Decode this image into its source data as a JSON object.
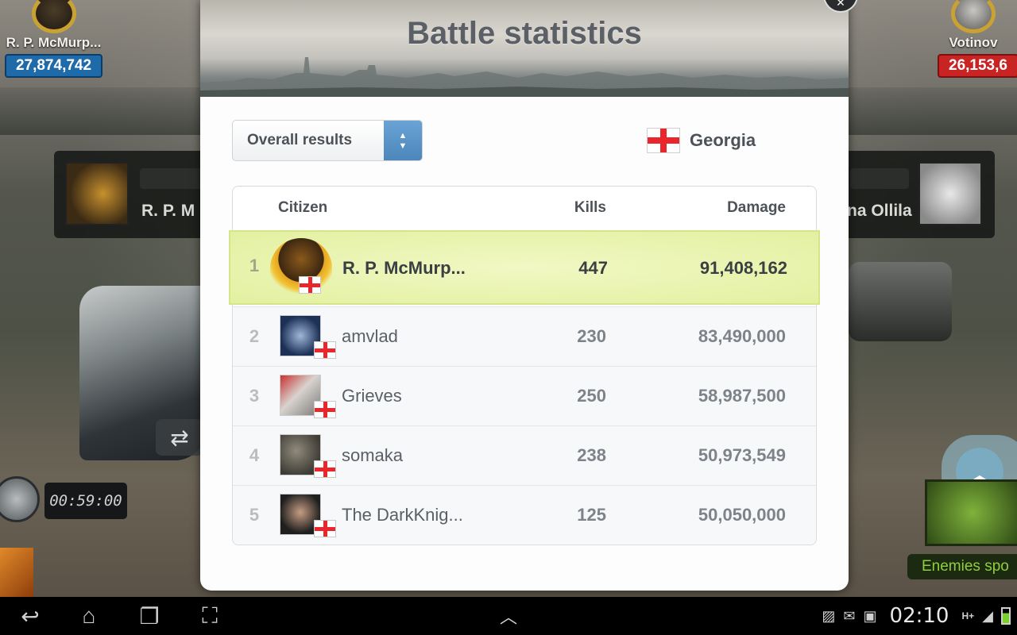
{
  "game": {
    "left_player": {
      "name": "R. P. McMurp...",
      "score": "27,874,742"
    },
    "right_player": {
      "name": "Votinov",
      "score": "26,153,6"
    },
    "left_panel_name": "R. P. M",
    "right_panel_name": "na Ollila",
    "timer": "00:59:00",
    "enemies_label": "Enemies spo"
  },
  "modal": {
    "title": "Battle statistics",
    "filter": {
      "selected": "Overall results"
    },
    "country": {
      "name": "Georgia",
      "flag_icon": "georgia-flag-icon"
    },
    "table": {
      "headers": {
        "citizen": "Citizen",
        "kills": "Kills",
        "damage": "Damage"
      },
      "rows": [
        {
          "rank": "1",
          "name": "R. P. McMurp...",
          "kills": "447",
          "damage": "91,408,162",
          "highlighted": true
        },
        {
          "rank": "2",
          "name": "amvlad",
          "kills": "230",
          "damage": "83,490,000"
        },
        {
          "rank": "3",
          "name": "Grieves",
          "kills": "250",
          "damage": "58,987,500"
        },
        {
          "rank": "4",
          "name": "somaka",
          "kills": "238",
          "damage": "50,973,549"
        },
        {
          "rank": "5",
          "name": "The DarkKnig...",
          "kills": "125",
          "damage": "50,050,000"
        }
      ]
    }
  },
  "system_bar": {
    "clock": "02:10",
    "network": "H+"
  },
  "colors": {
    "highlight_row": "#e8f3b0",
    "select_arrow_bg": "#5b94c7",
    "score_blue": "#1f6aa8",
    "score_red": "#c92424",
    "georgia_red": "#e8262b"
  }
}
